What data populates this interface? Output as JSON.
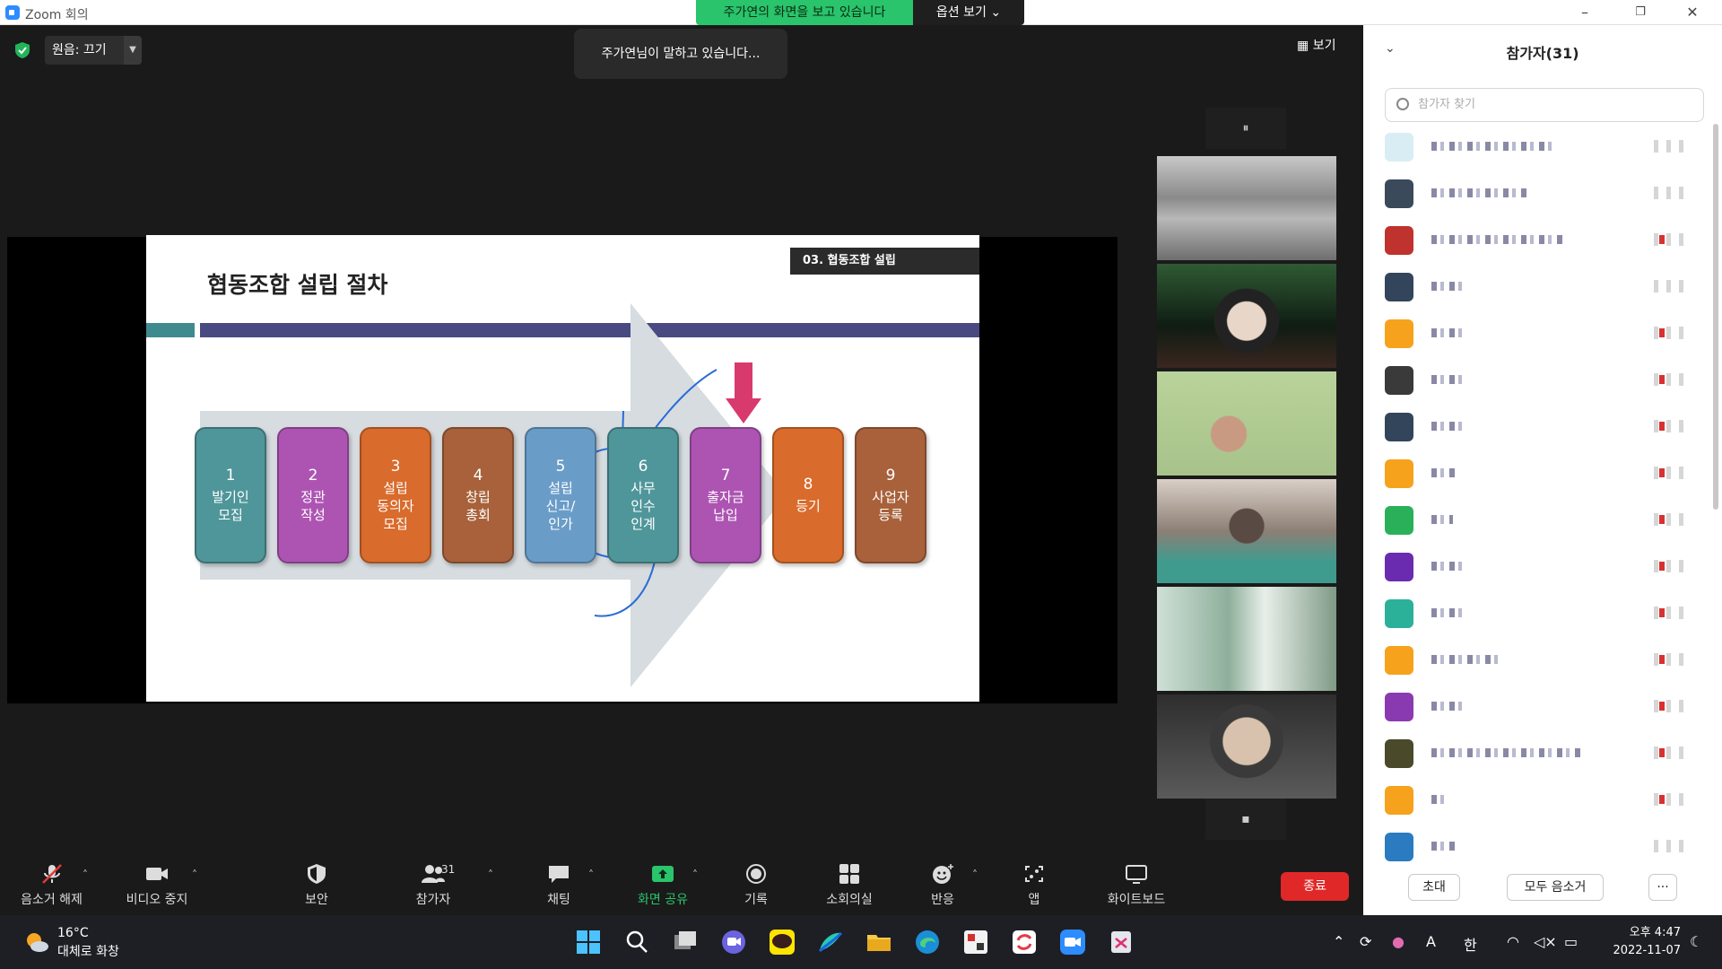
{
  "window": {
    "title": "Zoom 회의",
    "minimize": "–",
    "restore": "❐",
    "close": "✕"
  },
  "share_banner": {
    "text": "주가연의 화면을 보고 있습니다",
    "options": "옵션 보기 ⌄"
  },
  "meeting": {
    "audio": "원음: 끄기",
    "speaking": "주가연님이 말하고 있습니다...",
    "view": "보기"
  },
  "slide": {
    "title": "협동조합 설립 절차",
    "section": "03. 협동조합 설립",
    "steps": [
      {
        "num": "1",
        "label": "발기인\n모집",
        "color": "#4f969a"
      },
      {
        "num": "2",
        "label": "정관\n작성",
        "color": "#ad54b3"
      },
      {
        "num": "3",
        "label": "설립\n동의자\n모집",
        "color": "#d96b2c"
      },
      {
        "num": "4",
        "label": "창립\n총회",
        "color": "#a8613a"
      },
      {
        "num": "5",
        "label": "설립\n신고/\n인가",
        "color": "#6a9cc8"
      },
      {
        "num": "6",
        "label": "사무\n인수\n인계",
        "color": "#4f969a"
      },
      {
        "num": "7",
        "label": "출자금\n납입",
        "color": "#ad54b3"
      },
      {
        "num": "8",
        "label": "등기",
        "color": "#d96b2c"
      },
      {
        "num": "9",
        "label": "사업자\n등록",
        "color": "#a8613a"
      }
    ]
  },
  "strip": {
    "up": "⏸",
    "down": "▪"
  },
  "panel": {
    "title": "참가자(31)",
    "search_placeholder": "참가자 찾기",
    "invite": "초대",
    "mute_all": "모두 음소거",
    "more": "···"
  },
  "toolbar": {
    "unmute": "음소거 해제",
    "stop_video": "비디오 중지",
    "security": "보안",
    "participants": "참가자",
    "participants_count": "31",
    "chat": "채팅",
    "share": "화면 공유",
    "record": "기록",
    "breakout": "소회의실",
    "reactions": "반응",
    "apps": "앱",
    "whiteboard": "화이트보드",
    "end": "종료"
  },
  "taskbar": {
    "temp": "16°C",
    "condition": "대체로 화창",
    "ime": "한",
    "lang": "A",
    "time": "오후 4:47",
    "date": "2022-11-07"
  },
  "colors": {
    "share_green": "#29c46b",
    "end_red": "#e02828",
    "zoom_blue": "#2d8cff"
  }
}
